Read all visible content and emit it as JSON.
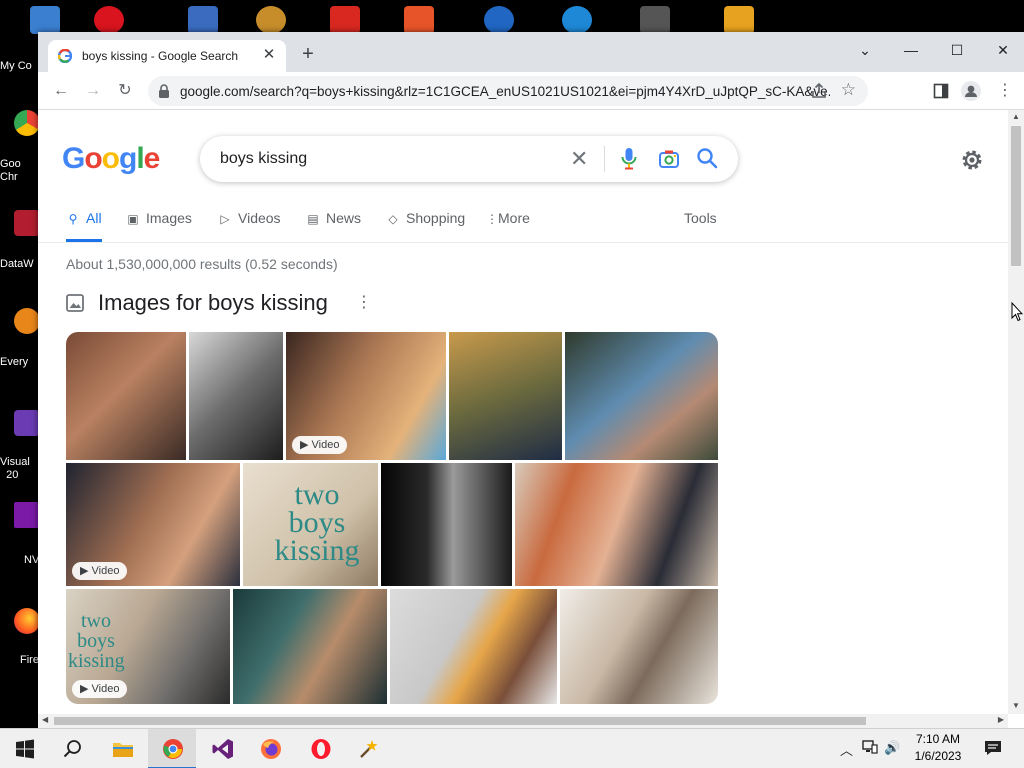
{
  "desktop": {
    "icons": [
      {
        "name": "my-computer",
        "label": "My Co"
      },
      {
        "name": "google-chrome",
        "label": "Goo\nChr"
      },
      {
        "name": "datawrapper",
        "label": "DataW"
      },
      {
        "name": "everything",
        "label": "Every"
      },
      {
        "name": "visual-studio",
        "label": "Visual\n20"
      },
      {
        "name": "nvivo",
        "label": "NV"
      },
      {
        "name": "firefox",
        "label": "Fire"
      }
    ]
  },
  "browser": {
    "tab_title": "boys kissing - Google Search",
    "url": "google.com/search?q=boys+kissing&rlz=1C1GCEA_enUS1021US1021&ei=pjm4Y4XrD_uJptQP_sC-KA&ve...",
    "window_controls": {
      "dropdown": "⌄",
      "minimize": "—",
      "maximize": "☐",
      "close": "✕"
    }
  },
  "search": {
    "query": "boys kissing",
    "tabs": [
      {
        "label": "All",
        "icon": "search-icon",
        "active": true
      },
      {
        "label": "Images",
        "icon": "image-icon"
      },
      {
        "label": "Videos",
        "icon": "video-icon"
      },
      {
        "label": "News",
        "icon": "news-icon"
      },
      {
        "label": "Shopping",
        "icon": "tag-icon"
      },
      {
        "label": "More",
        "icon": "more-vert-icon"
      }
    ],
    "tools_label": "Tools",
    "result_stats": "About 1,530,000,000 results (0.52 seconds)",
    "images_header": "Images for boys kissing",
    "video_badge": "Video"
  },
  "thumbnails": [
    {
      "name": "thumb-1",
      "video": false
    },
    {
      "name": "thumb-2",
      "video": false
    },
    {
      "name": "thumb-3",
      "video": true
    },
    {
      "name": "thumb-4",
      "video": false
    },
    {
      "name": "thumb-5",
      "video": false
    },
    {
      "name": "thumb-6",
      "video": true
    },
    {
      "name": "thumb-7",
      "video": false,
      "overlay_text": "two boys kissing"
    },
    {
      "name": "thumb-8",
      "video": false
    },
    {
      "name": "thumb-9",
      "video": false
    },
    {
      "name": "thumb-10",
      "video": true,
      "overlay_text": "two boys kissing"
    },
    {
      "name": "thumb-11",
      "video": false
    },
    {
      "name": "thumb-12",
      "video": false
    },
    {
      "name": "thumb-13",
      "video": false
    }
  ],
  "taskbar": {
    "time": "7:10 AM",
    "date": "1/6/2023",
    "apps": [
      "start",
      "search",
      "file-explorer",
      "google-chrome",
      "visual-studio",
      "firefox",
      "opera",
      "magic-wand-tool"
    ]
  },
  "colors": {
    "google_blue": "#4285f4",
    "google_red": "#ea4335",
    "google_yellow": "#fbbc05",
    "google_green": "#34a853",
    "link_blue": "#1a73e8"
  }
}
